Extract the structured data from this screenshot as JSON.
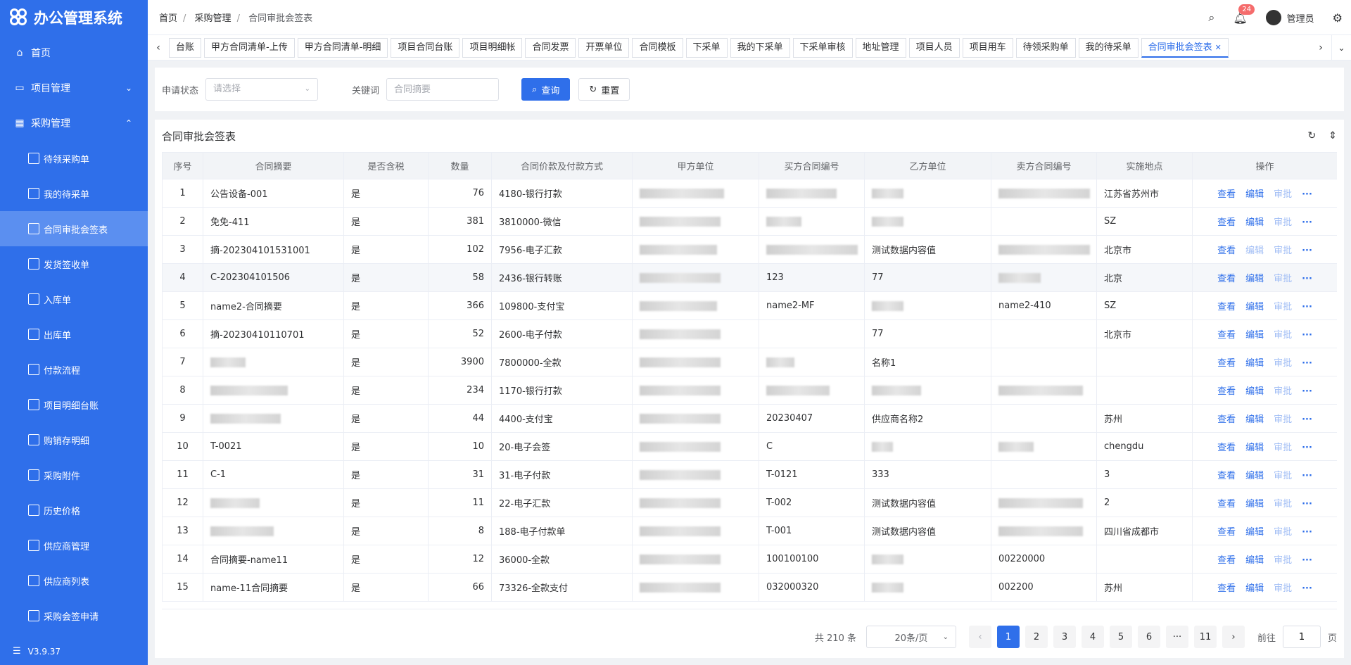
{
  "app": {
    "title": "办公管理系统",
    "version": "V3.9.37"
  },
  "sidebar": {
    "items": [
      {
        "label": "首页",
        "icon": "home-icon"
      },
      {
        "label": "项目管理",
        "icon": "folder-icon",
        "arrow": "⌄"
      },
      {
        "label": "采购管理",
        "icon": "table-icon",
        "arrow": "⌃"
      }
    ],
    "sub": [
      {
        "label": "待领采购单"
      },
      {
        "label": "我的待采单"
      },
      {
        "label": "合同审批会签表",
        "active": true
      },
      {
        "label": "发货签收单"
      },
      {
        "label": "入库单"
      },
      {
        "label": "出库单"
      },
      {
        "label": "付款流程"
      },
      {
        "label": "项目明细台账"
      },
      {
        "label": "购销存明细"
      },
      {
        "label": "采购附件"
      },
      {
        "label": "历史价格"
      },
      {
        "label": "供应商管理"
      },
      {
        "label": "供应商列表"
      },
      {
        "label": "采购会签申请"
      }
    ]
  },
  "breadcrumb": [
    "首页",
    "采购管理",
    "合同审批会签表"
  ],
  "header": {
    "badge": "24",
    "user": "管理员"
  },
  "tabs": [
    "台账",
    "甲方合同清单-上传",
    "甲方合同清单-明细",
    "项目合同台账",
    "项目明细帐",
    "合同发票",
    "开票单位",
    "合同模板",
    "下采单",
    "我的下采单",
    "下采单审核",
    "地址管理",
    "项目人员",
    "项目用车",
    "待领采购单",
    "我的待采单",
    "合同审批会签表"
  ],
  "filter": {
    "status_label": "申请状态",
    "status_placeholder": "请选择",
    "keyword_label": "关键词",
    "keyword_placeholder": "合同摘要",
    "search": "查询",
    "reset": "重置"
  },
  "panel": {
    "title": "合同审批会签表"
  },
  "table": {
    "headers": [
      "序号",
      "合同摘要",
      "是否含税",
      "数量",
      "合同价款及付款方式",
      "甲方单位",
      "买方合同编号",
      "乙方单位",
      "卖方合同编号",
      "实施地点",
      "操作"
    ],
    "ops": {
      "view": "查看",
      "edit": "编辑",
      "approve": "审批",
      "more": "···"
    },
    "rows": [
      [
        "1",
        "公告设备-001",
        "是",
        "76",
        "4180-银行打款",
        "",
        "",
        "",
        "",
        "江苏省苏州市"
      ],
      [
        "2",
        "免免-411",
        "是",
        "381",
        "3810000-微信",
        "",
        "",
        "",
        "",
        "SZ"
      ],
      [
        "3",
        "摘-202304101531001",
        "是",
        "102",
        "7956-电子汇款",
        "",
        "",
        "测试数据内容值",
        "",
        "北京市"
      ],
      [
        "4",
        "C-202304101506",
        "是",
        "58",
        "2436-银行转账",
        "",
        "123",
        "77",
        "",
        "北京"
      ],
      [
        "5",
        "name2-合同摘要",
        "是",
        "366",
        "109800-支付宝",
        "",
        "name2-MF",
        "",
        "name2-410",
        "SZ"
      ],
      [
        "6",
        "摘-20230410110701",
        "是",
        "52",
        "2600-电子付款",
        "",
        "",
        "77",
        "",
        "北京市"
      ],
      [
        "7",
        "",
        "是",
        "3900",
        "7800000-全款",
        "",
        "",
        "名称1",
        "",
        ""
      ],
      [
        "8",
        "",
        "是",
        "234",
        "1170-银行打款",
        "",
        "",
        "",
        "",
        ""
      ],
      [
        "9",
        "",
        "是",
        "44",
        "4400-支付宝",
        "",
        "20230407",
        "供应商名称2",
        "",
        "苏州"
      ],
      [
        "10",
        "T-0021",
        "是",
        "10",
        "20-电子会签",
        "",
        "C",
        "",
        "",
        "chengdu"
      ],
      [
        "11",
        "C-1",
        "是",
        "31",
        "31-电子付款",
        "",
        "T-0121",
        "333",
        "",
        "3"
      ],
      [
        "12",
        "",
        "是",
        "11",
        "22-电子汇款",
        "",
        "T-002",
        "测试数据内容值",
        "",
        "2"
      ],
      [
        "13",
        "",
        "是",
        "8",
        "188-电子付款单",
        "",
        "T-001",
        "测试数据内容值",
        "",
        "四川省成都市"
      ],
      [
        "14",
        "合同摘要-name11",
        "是",
        "12",
        "36000-全款",
        "",
        "100100100",
        "",
        "00220000",
        ""
      ],
      [
        "15",
        "name-11合同摘要",
        "是",
        "66",
        "73326-全款支付",
        "",
        "032000320",
        "",
        "002200",
        "苏州"
      ]
    ]
  },
  "pagination": {
    "total": "共 210 条",
    "page_size": "20条/页",
    "pages": [
      "1",
      "2",
      "3",
      "4",
      "5",
      "6",
      "···",
      "11"
    ],
    "current": "1",
    "goto_label": "前往",
    "goto_value": "1",
    "page_unit": "页"
  }
}
